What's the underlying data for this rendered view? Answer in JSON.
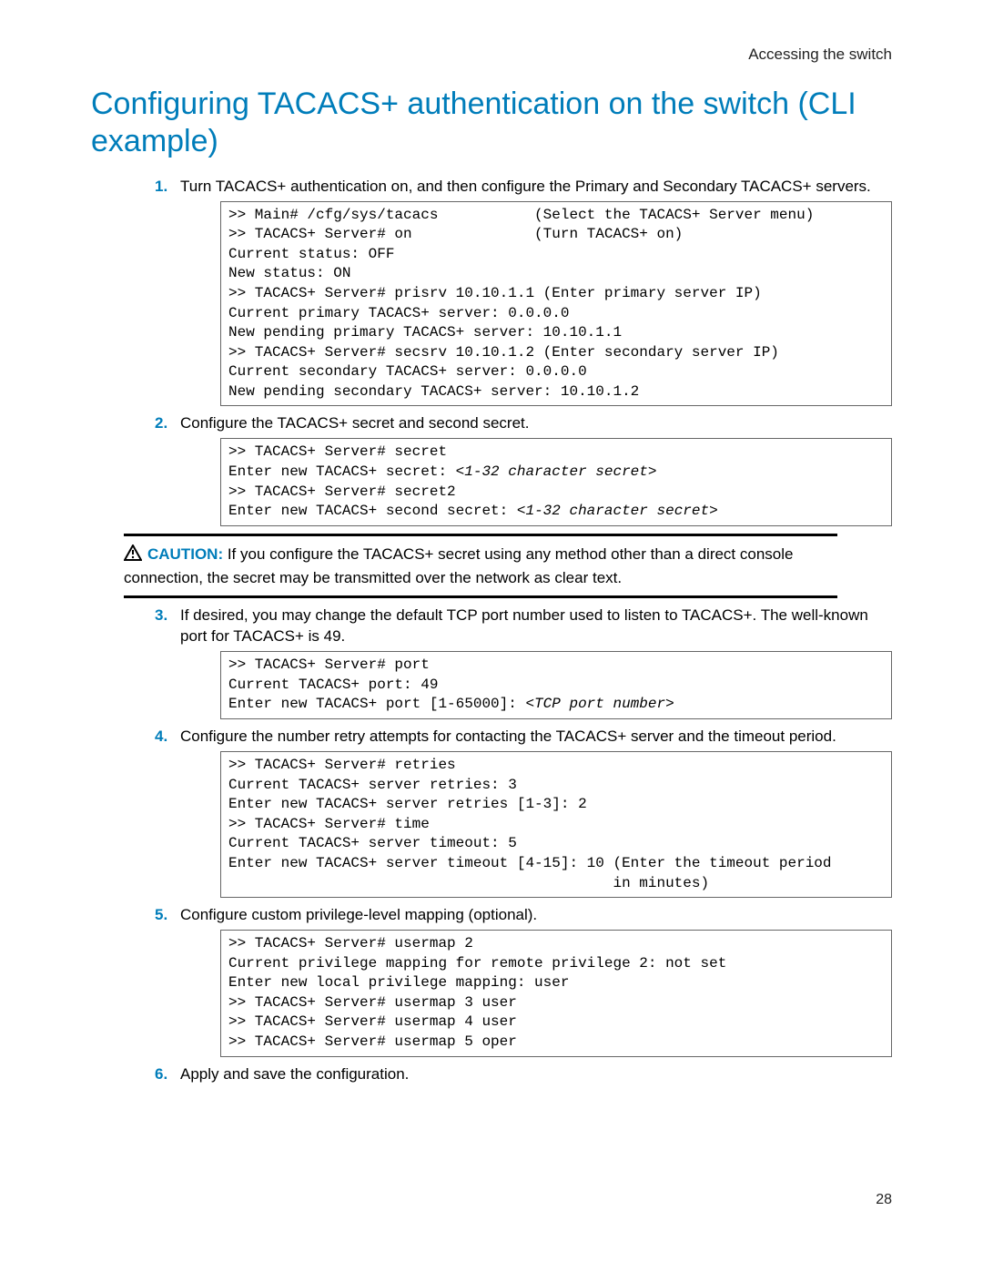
{
  "header": {
    "section": "Accessing the switch"
  },
  "title": "Configuring TACACS+ authentication on the switch (CLI example)",
  "steps": [
    {
      "num": "1.",
      "text": "Turn TACACS+ authentication on, and then configure the Primary and Secondary TACACS+ servers.",
      "code": ">> Main# /cfg/sys/tacacs           (Select the TACACS+ Server menu)\n>> TACACS+ Server# on              (Turn TACACS+ on)\nCurrent status: OFF\nNew status: ON\n>> TACACS+ Server# prisrv 10.10.1.1 (Enter primary server IP)\nCurrent primary TACACS+ server: 0.0.0.0\nNew pending primary TACACS+ server: 10.10.1.1\n>> TACACS+ Server# secsrv 10.10.1.2 (Enter secondary server IP)\nCurrent secondary TACACS+ server: 0.0.0.0\nNew pending secondary TACACS+ server: 10.10.1.2"
    },
    {
      "num": "2.",
      "text": "Configure the TACACS+ secret and second secret.",
      "code_html": ">> TACACS+ Server# secret\nEnter new TACACS+ secret: <span class=\"it\">&lt;1-32 character secret&gt;</span>\n>> TACACS+ Server# secret2\nEnter new TACACS+ second secret: <span class=\"it\">&lt;1-32 character secret&gt;</span>"
    }
  ],
  "caution": {
    "label": "CAUTION:",
    "text": " If you configure the TACACS+ secret using any method other than a direct console connection, the secret may be transmitted over the network as clear text."
  },
  "steps2": [
    {
      "num": "3.",
      "text": "If desired, you may change the default TCP port number used to listen to TACACS+. The well-known port for TACACS+ is 49.",
      "code_html": ">> TACACS+ Server# port\nCurrent TACACS+ port: 49\nEnter new TACACS+ port [1-65000]: <span class=\"it\">&lt;TCP port number&gt;</span>"
    },
    {
      "num": "4.",
      "text": "Configure the number retry attempts for contacting the TACACS+ server and the timeout period.",
      "code": ">> TACACS+ Server# retries\nCurrent TACACS+ server retries: 3\nEnter new TACACS+ server retries [1-3]: 2\n>> TACACS+ Server# time\nCurrent TACACS+ server timeout: 5\nEnter new TACACS+ server timeout [4-15]: 10 (Enter the timeout period\n                                            in minutes)"
    },
    {
      "num": "5.",
      "text": "Configure custom privilege-level mapping (optional).",
      "code": ">> TACACS+ Server# usermap 2\nCurrent privilege mapping for remote privilege 2: not set\nEnter new local privilege mapping: user\n>> TACACS+ Server# usermap 3 user\n>> TACACS+ Server# usermap 4 user\n>> TACACS+ Server# usermap 5 oper"
    },
    {
      "num": "6.",
      "text": "Apply and save the configuration."
    }
  ],
  "page_number": "28"
}
